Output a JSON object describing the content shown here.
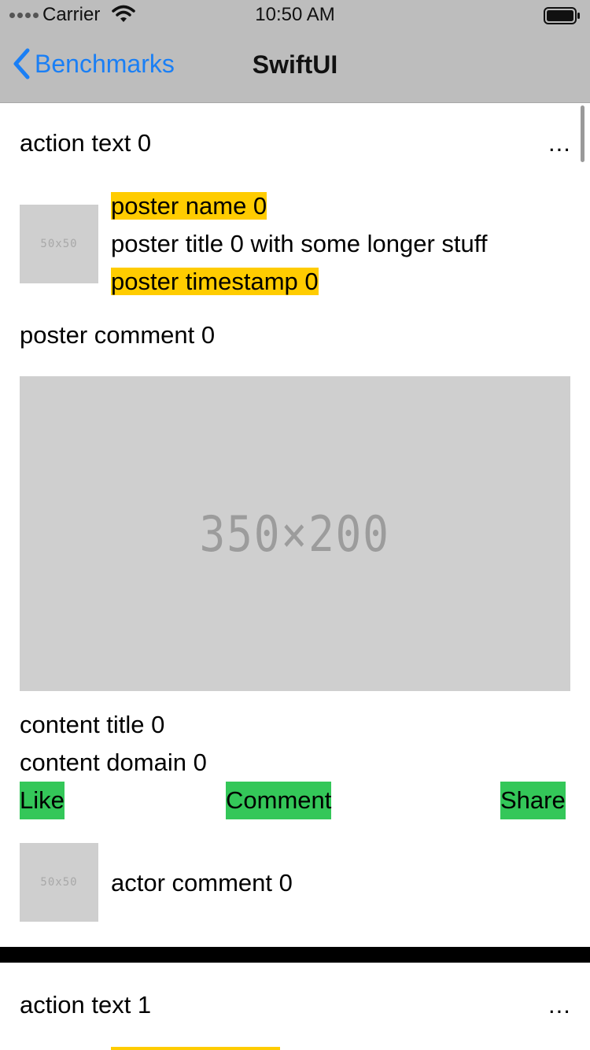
{
  "status_bar": {
    "carrier": "Carrier",
    "time": "10:50 AM",
    "icons": [
      "signal-dots-icon",
      "wifi-icon",
      "battery-icon"
    ]
  },
  "nav": {
    "back_label": "Benchmarks",
    "back_icon": "chevron-left-icon",
    "title": "SwiftUI"
  },
  "colors": {
    "nav_background": "#bdbdbd",
    "link_blue": "#1a7ff5",
    "highlight_yellow": "#ffcc00",
    "button_green": "#34c759",
    "placeholder_gray": "#cfcfcf"
  },
  "posts": [
    {
      "action_text": "action text 0",
      "more": "...",
      "poster_thumb": "50x50",
      "poster_name": "poster name 0",
      "poster_title": "poster title 0 with some longer stuff",
      "poster_timestamp": "poster timestamp 0",
      "poster_comment": "poster comment 0",
      "content_image": "350×200",
      "content_title": "content title 0",
      "content_domain": "content domain 0",
      "buttons": {
        "like": "Like",
        "comment": "Comment",
        "share": "Share"
      },
      "actor_thumb": "50x50",
      "actor_comment": "actor comment 0"
    },
    {
      "action_text": "action text 1",
      "more": "..."
    }
  ]
}
